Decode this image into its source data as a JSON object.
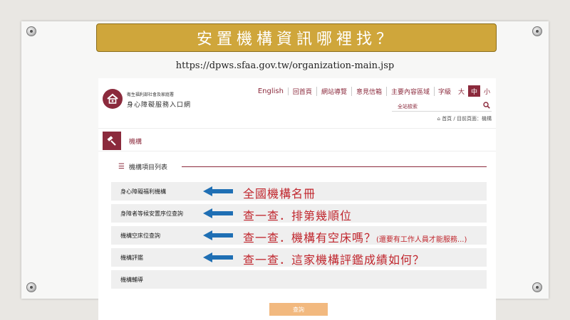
{
  "slide": {
    "title": "安置機構資訊哪裡找？",
    "url": "https://dpws.sfaa.gov.tw/organization-main.jsp"
  },
  "site": {
    "org_line1": "衛生福利部社會及家庭署",
    "org_line2": "身心障礙服務入口網",
    "nav": [
      "English",
      "回首頁",
      "網站導覽",
      "意見信箱",
      "主要內容區域"
    ],
    "font_size_label": "字級",
    "font_sizes": [
      "大",
      "中",
      "小"
    ],
    "search_placeholder": "全站檢索",
    "breadcrumb": "首頁 / 目前頁面：機構",
    "page_title": "機構"
  },
  "list": {
    "heading": "機構項目列表",
    "rows": [
      {
        "label": "身心障礙福利機構",
        "note": "全國機構名冊",
        "note_small": ""
      },
      {
        "label": "身障者等候安置序位查詢",
        "note": "查一查．排第幾順位",
        "note_small": ""
      },
      {
        "label": "機構空床位查詢",
        "note": "查一查．機構有空床嗎？",
        "note_small": "(還要有工作人員才能服務...)"
      },
      {
        "label": "機構評鑑",
        "note": "查一查．這家機構評鑑成績如何？",
        "note_small": ""
      },
      {
        "label": "機構輔導",
        "note": "",
        "note_small": ""
      }
    ],
    "submit_label": "查詢"
  },
  "colors": {
    "banner": "#cfa63b",
    "brand": "#8b2a3c",
    "annotation": "#c0262d",
    "arrow": "#1f6fb4"
  }
}
